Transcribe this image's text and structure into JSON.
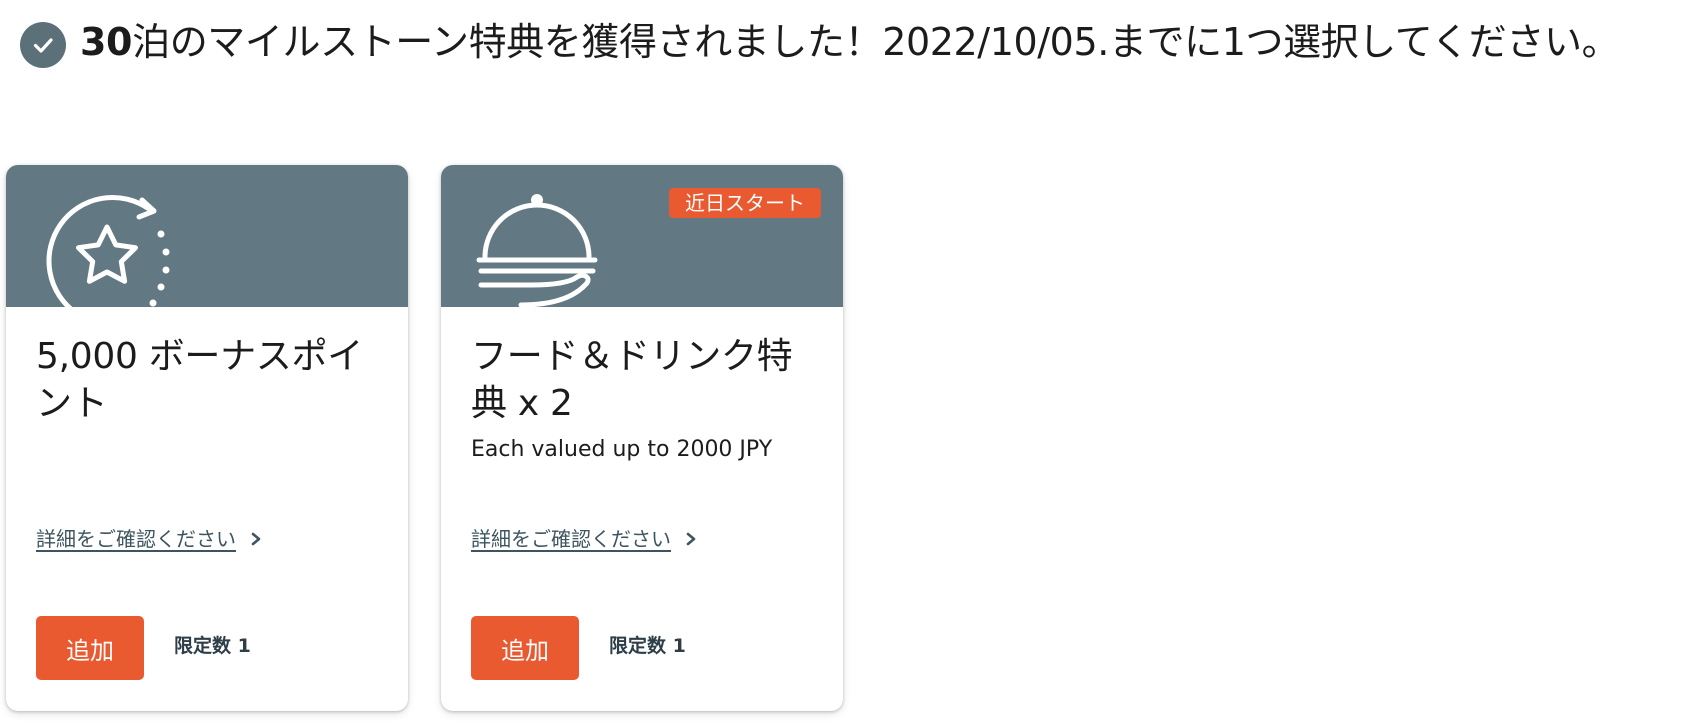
{
  "heading": {
    "nights": "30",
    "text": "泊のマイルストーン特典を獲得されました！2022/10/05.までに1つ選択してください。"
  },
  "colors": {
    "header_bg": "#627983",
    "accent": "#e95a30",
    "check_bg": "#5b7079"
  },
  "cards": [
    {
      "icon": "rotating-star-icon",
      "title": "5,000 ボーナスポイント",
      "subtitle": "",
      "detail_link": "詳細をご確認ください",
      "add_label": "追加",
      "limit": "限定数 1"
    },
    {
      "icon": "food-cloche-icon",
      "badge": "近日スタート",
      "title": "フード＆ドリンク特典 x 2",
      "subtitle": "Each valued up to 2000 JPY",
      "detail_link": "詳細をご確認ください",
      "add_label": "追加",
      "limit": "限定数 1"
    }
  ]
}
